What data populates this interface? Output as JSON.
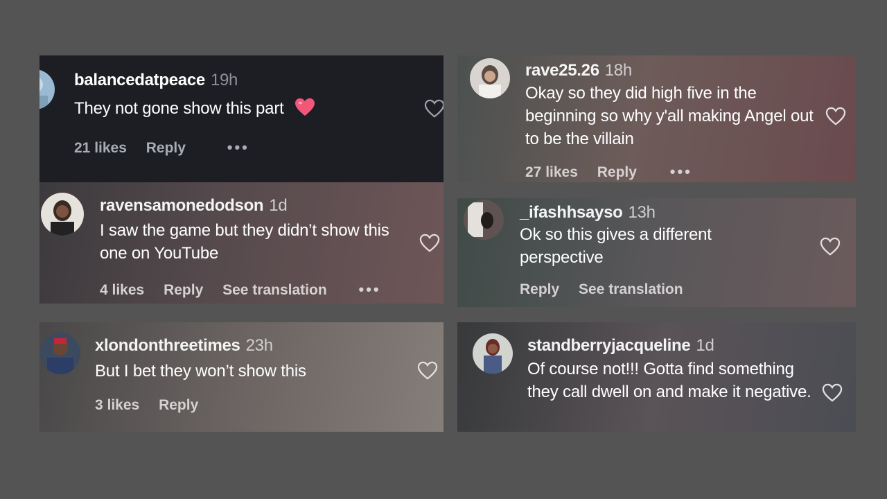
{
  "comments": [
    {
      "username": "balancedatpeace",
      "time": "19h",
      "text": "They not gone show this part",
      "emoji": "heart",
      "likes": "21 likes",
      "reply": "Reply",
      "dots": "•••"
    },
    {
      "username": "ravensamonedodson",
      "time": "1d",
      "text": "I saw the game but they didn’t show this one on YouTube",
      "likes": "4 likes",
      "reply": "Reply",
      "translate": "See translation",
      "dots": "•••"
    },
    {
      "username": "xlondonthreetimes",
      "time": "23h",
      "text": "But I bet they won’t show this",
      "likes": "3 likes",
      "reply": "Reply"
    },
    {
      "username": "rave25.26",
      "time": "18h",
      "text": "Okay so they did high five in the beginning so why y'all making Angel out to be the villain",
      "likes": "27 likes",
      "reply": "Reply",
      "dots": "•••"
    },
    {
      "username": "_ifashhsayso",
      "time": "13h",
      "text": "Ok so this gives a different perspective",
      "reply": "Reply",
      "translate": "See translation"
    },
    {
      "username": "standberryjacqueline",
      "time": "1d",
      "text": "Of course not!!! Gotta find something they call dwell on and make it negative.",
      "likes": "",
      "reply": ""
    }
  ],
  "colors": {
    "background": "#545454",
    "dark_card": "#1c1e23",
    "emoji_heart": "#f2577a"
  }
}
